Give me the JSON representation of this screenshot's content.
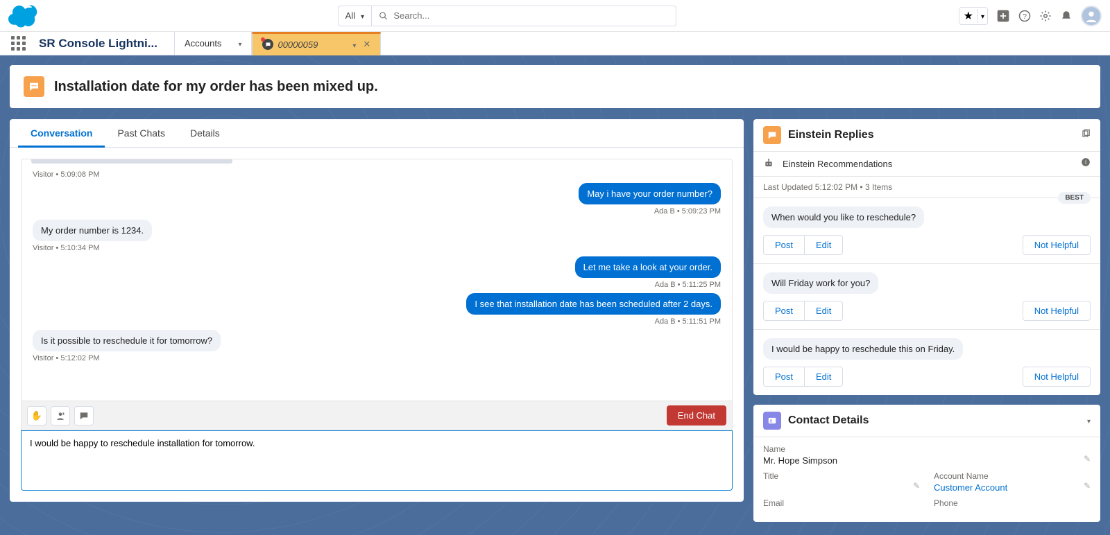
{
  "header": {
    "search_scope": "All",
    "search_placeholder": "Search..."
  },
  "nav": {
    "app_name": "SR Console Lightni...",
    "tabs": [
      {
        "label": "Accounts",
        "active": false,
        "closable": false
      },
      {
        "label": "00000059",
        "active": true,
        "closable": true,
        "chat": true
      }
    ]
  },
  "case": {
    "title": "Installation date for my order has been mixed up."
  },
  "main_tabs": [
    "Conversation",
    "Past Chats",
    "Details"
  ],
  "active_main_tab": 0,
  "chat": {
    "messages": [
      {
        "side": "left",
        "meta": "Visitor • 5:09:08 PM",
        "text": ""
      },
      {
        "side": "right",
        "meta": "Ada B • 5:09:23 PM",
        "text": "May i have your order number?"
      },
      {
        "side": "left",
        "meta": "Visitor • 5:10:34 PM",
        "text": "My order number is 1234."
      },
      {
        "side": "right",
        "meta": "Ada B • 5:11:25 PM",
        "text": "Let me take a look at your order."
      },
      {
        "side": "right",
        "meta": "Ada B • 5:11:51 PM",
        "text": "I see that installation date has been scheduled after 2 days."
      },
      {
        "side": "left",
        "meta": "Visitor • 5:12:02 PM",
        "text": "Is it possible to reschedule it for tomorrow?"
      }
    ],
    "end_chat_label": "End Chat",
    "compose_value": "I would be happy to reschedule installation for tomorrow."
  },
  "einstein": {
    "title": "Einstein Replies",
    "subtitle": "Einstein Recommendations",
    "last_updated": "Last Updated 5:12:02 PM • 3 Items",
    "best_label": "BEST",
    "post_label": "Post",
    "edit_label": "Edit",
    "not_helpful_label": "Not Helpful",
    "replies": [
      {
        "text": "When would you like to reschedule?",
        "best": true
      },
      {
        "text": "Will Friday work for you?",
        "best": false
      },
      {
        "text": "I would be happy to reschedule this on Friday.",
        "best": false
      }
    ]
  },
  "contact": {
    "title": "Contact Details",
    "fields": {
      "name_label": "Name",
      "name_value": "Mr. Hope Simpson",
      "title_label": "Title",
      "title_value": "",
      "account_label": "Account Name",
      "account_value": "Customer Account",
      "email_label": "Email",
      "phone_label": "Phone"
    }
  }
}
